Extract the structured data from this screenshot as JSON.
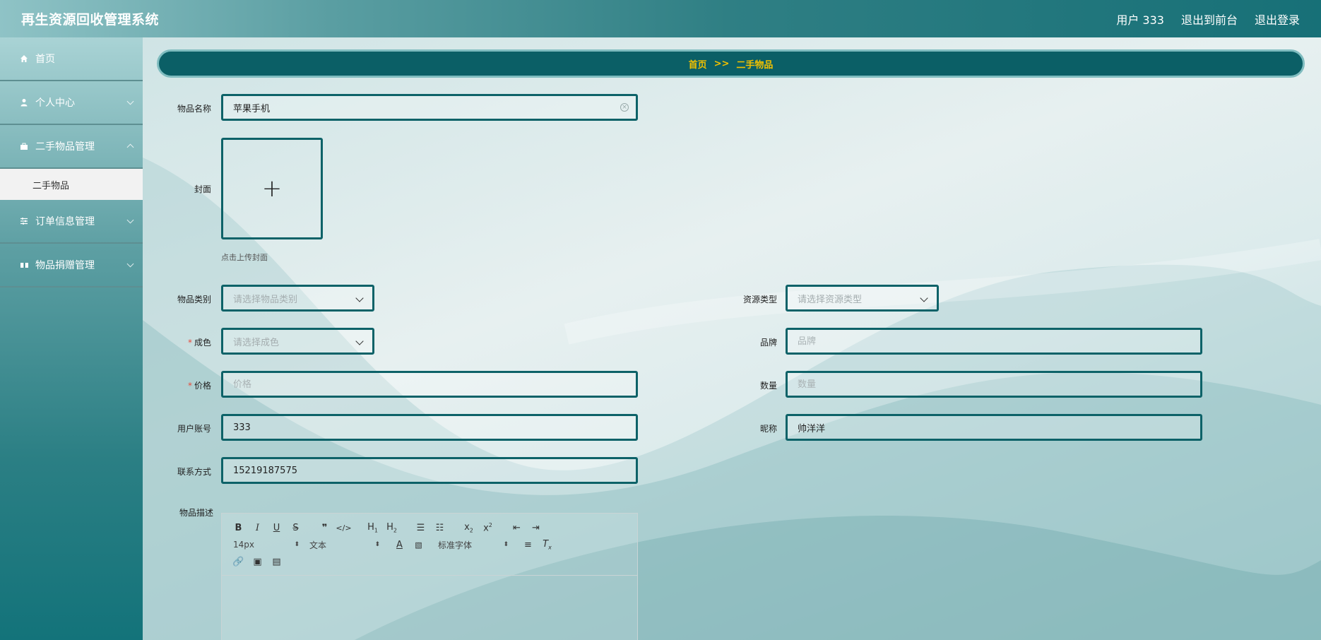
{
  "header": {
    "title": "再生资源回收管理系统",
    "user": "用户 333",
    "back_to_front": "退出到前台",
    "logout": "退出登录"
  },
  "sidebar": {
    "items": [
      {
        "label": "首页",
        "icon": "home-icon"
      },
      {
        "label": "个人中心",
        "icon": "user-icon"
      },
      {
        "label": "二手物品管理",
        "icon": "briefcase-icon"
      },
      {
        "label": "订单信息管理",
        "icon": "sliders-icon"
      },
      {
        "label": "物品捐赠管理",
        "icon": "gift-icon"
      }
    ],
    "submenu": {
      "label": "二手物品"
    }
  },
  "breadcrumb": {
    "home": "首页",
    "separator": ">>",
    "current": "二手物品"
  },
  "form": {
    "name": {
      "label": "物品名称",
      "value": "苹果手机"
    },
    "cover": {
      "label": "封面",
      "hint": "点击上传封面"
    },
    "category": {
      "label": "物品类别",
      "placeholder": "请选择物品类别"
    },
    "resource_type": {
      "label": "资源类型",
      "placeholder": "请选择资源类型"
    },
    "condition": {
      "label": "成色",
      "placeholder": "请选择成色"
    },
    "brand": {
      "label": "品牌",
      "placeholder": "品牌"
    },
    "price": {
      "label": "价格",
      "placeholder": "价格"
    },
    "quantity": {
      "label": "数量",
      "placeholder": "数量"
    },
    "account": {
      "label": "用户账号",
      "value": "333"
    },
    "nickname": {
      "label": "昵称",
      "value": "帅洋洋"
    },
    "contact": {
      "label": "联系方式",
      "value": "15219187575"
    },
    "description": {
      "label": "物品描述"
    }
  },
  "editor": {
    "font_size": "14px",
    "text_style": "文本",
    "font_family": "标准字体"
  }
}
